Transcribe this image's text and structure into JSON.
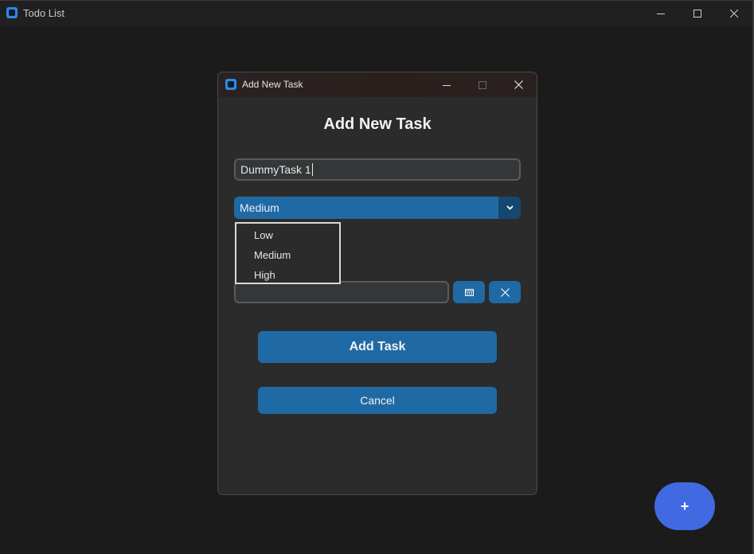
{
  "window": {
    "title": "Todo List",
    "icon": "app-icon"
  },
  "dialog": {
    "window_title": "Add New Task",
    "heading": "Add New Task",
    "task_input": {
      "value": "DummyTask 1",
      "placeholder": ""
    },
    "priority": {
      "selected": "Medium",
      "options": [
        "Low",
        "Medium",
        "High"
      ],
      "dropdown_open": true
    },
    "due_date": {
      "value": "",
      "calendar_icon": "calendar-icon",
      "clear_icon": "close-icon"
    },
    "add_button_label": "Add Task",
    "cancel_button_label": "Cancel"
  },
  "fab": {
    "label": "+"
  },
  "colors": {
    "background": "#1b1b1b",
    "dialog_bg": "#2b2b2b",
    "accent": "#1f6aa5",
    "accent_dark": "#144870",
    "fab": "#4169e1",
    "input_bg": "#343638",
    "input_border": "#565b5e"
  }
}
